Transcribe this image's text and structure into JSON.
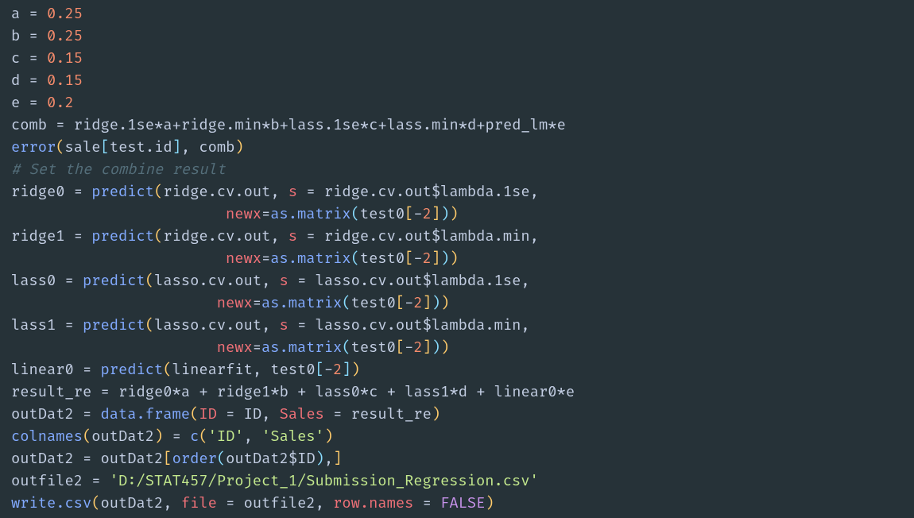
{
  "code": {
    "lines": [
      [
        {
          "c": "tok-id",
          "t": "a "
        },
        {
          "c": "tok-op",
          "t": "= "
        },
        {
          "c": "tok-num",
          "t": "0.25"
        }
      ],
      [
        {
          "c": "tok-id",
          "t": "b "
        },
        {
          "c": "tok-op",
          "t": "= "
        },
        {
          "c": "tok-num",
          "t": "0.25"
        }
      ],
      [
        {
          "c": "tok-id",
          "t": "c "
        },
        {
          "c": "tok-op",
          "t": "= "
        },
        {
          "c": "tok-num",
          "t": "0.15"
        }
      ],
      [
        {
          "c": "tok-id",
          "t": "d "
        },
        {
          "c": "tok-op",
          "t": "= "
        },
        {
          "c": "tok-num",
          "t": "0.15"
        }
      ],
      [
        {
          "c": "tok-id",
          "t": "e "
        },
        {
          "c": "tok-op",
          "t": "= "
        },
        {
          "c": "tok-num",
          "t": "0.2"
        }
      ],
      [
        {
          "c": "tok-id",
          "t": "comb "
        },
        {
          "c": "tok-op",
          "t": "= "
        },
        {
          "c": "tok-id",
          "t": "ridge.1se"
        },
        {
          "c": "tok-op",
          "t": "*"
        },
        {
          "c": "tok-id",
          "t": "a"
        },
        {
          "c": "tok-op",
          "t": "+"
        },
        {
          "c": "tok-id",
          "t": "ridge.min"
        },
        {
          "c": "tok-op",
          "t": "*"
        },
        {
          "c": "tok-id",
          "t": "b"
        },
        {
          "c": "tok-op",
          "t": "+"
        },
        {
          "c": "tok-id",
          "t": "lass.1se"
        },
        {
          "c": "tok-op",
          "t": "*"
        },
        {
          "c": "tok-id",
          "t": "c"
        },
        {
          "c": "tok-op",
          "t": "+"
        },
        {
          "c": "tok-id",
          "t": "lass.min"
        },
        {
          "c": "tok-op",
          "t": "*"
        },
        {
          "c": "tok-id",
          "t": "d"
        },
        {
          "c": "tok-op",
          "t": "+"
        },
        {
          "c": "tok-id",
          "t": "pred_lm"
        },
        {
          "c": "tok-op",
          "t": "*"
        },
        {
          "c": "tok-id",
          "t": "e"
        }
      ],
      [
        {
          "c": "tok-fn",
          "t": "error"
        },
        {
          "c": "tok-par",
          "t": "("
        },
        {
          "c": "tok-id",
          "t": "sale"
        },
        {
          "c": "tok-par2",
          "t": "["
        },
        {
          "c": "tok-id",
          "t": "test.id"
        },
        {
          "c": "tok-par2",
          "t": "]"
        },
        {
          "c": "tok-pun",
          "t": ", "
        },
        {
          "c": "tok-id",
          "t": "comb"
        },
        {
          "c": "tok-par",
          "t": ")"
        }
      ],
      [
        {
          "c": "tok-cmt",
          "t": "# Set the combine result"
        }
      ],
      [
        {
          "c": "tok-id",
          "t": "ridge0 "
        },
        {
          "c": "tok-op",
          "t": "= "
        },
        {
          "c": "tok-fn",
          "t": "predict"
        },
        {
          "c": "tok-par",
          "t": "("
        },
        {
          "c": "tok-id",
          "t": "ridge.cv.out"
        },
        {
          "c": "tok-pun",
          "t": ", "
        },
        {
          "c": "tok-arg",
          "t": "s "
        },
        {
          "c": "tok-op",
          "t": "= "
        },
        {
          "c": "tok-id",
          "t": "ridge.cv.out"
        },
        {
          "c": "tok-op",
          "t": "$"
        },
        {
          "c": "tok-id",
          "t": "lambda.1se"
        },
        {
          "c": "tok-pun",
          "t": ","
        }
      ],
      [
        {
          "c": "tok-id",
          "t": "                        "
        },
        {
          "c": "tok-arg",
          "t": "newx"
        },
        {
          "c": "tok-op",
          "t": "="
        },
        {
          "c": "tok-fn",
          "t": "as.matrix"
        },
        {
          "c": "tok-par2",
          "t": "("
        },
        {
          "c": "tok-id",
          "t": "test0"
        },
        {
          "c": "tok-par",
          "t": "["
        },
        {
          "c": "tok-op",
          "t": "-"
        },
        {
          "c": "tok-num",
          "t": "2"
        },
        {
          "c": "tok-par",
          "t": "]"
        },
        {
          "c": "tok-par2",
          "t": ")"
        },
        {
          "c": "tok-par",
          "t": ")"
        }
      ],
      [
        {
          "c": "tok-id",
          "t": "ridge1 "
        },
        {
          "c": "tok-op",
          "t": "= "
        },
        {
          "c": "tok-fn",
          "t": "predict"
        },
        {
          "c": "tok-par",
          "t": "("
        },
        {
          "c": "tok-id",
          "t": "ridge.cv.out"
        },
        {
          "c": "tok-pun",
          "t": ", "
        },
        {
          "c": "tok-arg",
          "t": "s "
        },
        {
          "c": "tok-op",
          "t": "= "
        },
        {
          "c": "tok-id",
          "t": "ridge.cv.out"
        },
        {
          "c": "tok-op",
          "t": "$"
        },
        {
          "c": "tok-id",
          "t": "lambda.min"
        },
        {
          "c": "tok-pun",
          "t": ","
        }
      ],
      [
        {
          "c": "tok-id",
          "t": "                        "
        },
        {
          "c": "tok-arg",
          "t": "newx"
        },
        {
          "c": "tok-op",
          "t": "="
        },
        {
          "c": "tok-fn",
          "t": "as.matrix"
        },
        {
          "c": "tok-par2",
          "t": "("
        },
        {
          "c": "tok-id",
          "t": "test0"
        },
        {
          "c": "tok-par",
          "t": "["
        },
        {
          "c": "tok-op",
          "t": "-"
        },
        {
          "c": "tok-num",
          "t": "2"
        },
        {
          "c": "tok-par",
          "t": "]"
        },
        {
          "c": "tok-par2",
          "t": ")"
        },
        {
          "c": "tok-par",
          "t": ")"
        }
      ],
      [
        {
          "c": "tok-id",
          "t": "lass0 "
        },
        {
          "c": "tok-op",
          "t": "= "
        },
        {
          "c": "tok-fn",
          "t": "predict"
        },
        {
          "c": "tok-par",
          "t": "("
        },
        {
          "c": "tok-id",
          "t": "lasso.cv.out"
        },
        {
          "c": "tok-pun",
          "t": ", "
        },
        {
          "c": "tok-arg",
          "t": "s "
        },
        {
          "c": "tok-op",
          "t": "= "
        },
        {
          "c": "tok-id",
          "t": "lasso.cv.out"
        },
        {
          "c": "tok-op",
          "t": "$"
        },
        {
          "c": "tok-id",
          "t": "lambda.1se"
        },
        {
          "c": "tok-pun",
          "t": ","
        }
      ],
      [
        {
          "c": "tok-id",
          "t": "                       "
        },
        {
          "c": "tok-arg",
          "t": "newx"
        },
        {
          "c": "tok-op",
          "t": "="
        },
        {
          "c": "tok-fn",
          "t": "as.matrix"
        },
        {
          "c": "tok-par2",
          "t": "("
        },
        {
          "c": "tok-id",
          "t": "test0"
        },
        {
          "c": "tok-par",
          "t": "["
        },
        {
          "c": "tok-op",
          "t": "-"
        },
        {
          "c": "tok-num",
          "t": "2"
        },
        {
          "c": "tok-par",
          "t": "]"
        },
        {
          "c": "tok-par2",
          "t": ")"
        },
        {
          "c": "tok-par",
          "t": ")"
        }
      ],
      [
        {
          "c": "tok-id",
          "t": "lass1 "
        },
        {
          "c": "tok-op",
          "t": "= "
        },
        {
          "c": "tok-fn",
          "t": "predict"
        },
        {
          "c": "tok-par",
          "t": "("
        },
        {
          "c": "tok-id",
          "t": "lasso.cv.out"
        },
        {
          "c": "tok-pun",
          "t": ", "
        },
        {
          "c": "tok-arg",
          "t": "s "
        },
        {
          "c": "tok-op",
          "t": "= "
        },
        {
          "c": "tok-id",
          "t": "lasso.cv.out"
        },
        {
          "c": "tok-op",
          "t": "$"
        },
        {
          "c": "tok-id",
          "t": "lambda.min"
        },
        {
          "c": "tok-pun",
          "t": ","
        }
      ],
      [
        {
          "c": "tok-id",
          "t": "                       "
        },
        {
          "c": "tok-arg",
          "t": "newx"
        },
        {
          "c": "tok-op",
          "t": "="
        },
        {
          "c": "tok-fn",
          "t": "as.matrix"
        },
        {
          "c": "tok-par2",
          "t": "("
        },
        {
          "c": "tok-id",
          "t": "test0"
        },
        {
          "c": "tok-par",
          "t": "["
        },
        {
          "c": "tok-op",
          "t": "-"
        },
        {
          "c": "tok-num",
          "t": "2"
        },
        {
          "c": "tok-par",
          "t": "]"
        },
        {
          "c": "tok-par2",
          "t": ")"
        },
        {
          "c": "tok-par",
          "t": ")"
        }
      ],
      [
        {
          "c": "tok-id",
          "t": "linear0 "
        },
        {
          "c": "tok-op",
          "t": "= "
        },
        {
          "c": "tok-fn",
          "t": "predict"
        },
        {
          "c": "tok-par",
          "t": "("
        },
        {
          "c": "tok-id",
          "t": "linearfit"
        },
        {
          "c": "tok-pun",
          "t": ", "
        },
        {
          "c": "tok-id",
          "t": "test0"
        },
        {
          "c": "tok-par2",
          "t": "["
        },
        {
          "c": "tok-op",
          "t": "-"
        },
        {
          "c": "tok-num",
          "t": "2"
        },
        {
          "c": "tok-par2",
          "t": "]"
        },
        {
          "c": "tok-par",
          "t": ")"
        }
      ],
      [
        {
          "c": "tok-id",
          "t": "result_re "
        },
        {
          "c": "tok-op",
          "t": "= "
        },
        {
          "c": "tok-id",
          "t": "ridge0"
        },
        {
          "c": "tok-op",
          "t": "*"
        },
        {
          "c": "tok-id",
          "t": "a "
        },
        {
          "c": "tok-op",
          "t": "+ "
        },
        {
          "c": "tok-id",
          "t": "ridge1"
        },
        {
          "c": "tok-op",
          "t": "*"
        },
        {
          "c": "tok-id",
          "t": "b "
        },
        {
          "c": "tok-op",
          "t": "+ "
        },
        {
          "c": "tok-id",
          "t": "lass0"
        },
        {
          "c": "tok-op",
          "t": "*"
        },
        {
          "c": "tok-id",
          "t": "c "
        },
        {
          "c": "tok-op",
          "t": "+ "
        },
        {
          "c": "tok-id",
          "t": "lass1"
        },
        {
          "c": "tok-op",
          "t": "*"
        },
        {
          "c": "tok-id",
          "t": "d "
        },
        {
          "c": "tok-op",
          "t": "+ "
        },
        {
          "c": "tok-id",
          "t": "linear0"
        },
        {
          "c": "tok-op",
          "t": "*"
        },
        {
          "c": "tok-id",
          "t": "e"
        }
      ],
      [
        {
          "c": "tok-id",
          "t": "outDat2 "
        },
        {
          "c": "tok-op",
          "t": "= "
        },
        {
          "c": "tok-fn",
          "t": "data.frame"
        },
        {
          "c": "tok-par",
          "t": "("
        },
        {
          "c": "tok-arg",
          "t": "ID "
        },
        {
          "c": "tok-op",
          "t": "= "
        },
        {
          "c": "tok-id",
          "t": "ID"
        },
        {
          "c": "tok-pun",
          "t": ", "
        },
        {
          "c": "tok-arg",
          "t": "Sales "
        },
        {
          "c": "tok-op",
          "t": "= "
        },
        {
          "c": "tok-id",
          "t": "result_re"
        },
        {
          "c": "tok-par",
          "t": ")"
        }
      ],
      [
        {
          "c": "tok-fn",
          "t": "colnames"
        },
        {
          "c": "tok-par",
          "t": "("
        },
        {
          "c": "tok-id",
          "t": "outDat2"
        },
        {
          "c": "tok-par",
          "t": ")"
        },
        {
          "c": "tok-op",
          "t": " = "
        },
        {
          "c": "tok-fn",
          "t": "c"
        },
        {
          "c": "tok-par",
          "t": "("
        },
        {
          "c": "tok-str",
          "t": "'ID'"
        },
        {
          "c": "tok-pun",
          "t": ", "
        },
        {
          "c": "tok-str",
          "t": "'Sales'"
        },
        {
          "c": "tok-par",
          "t": ")"
        }
      ],
      [
        {
          "c": "tok-id",
          "t": "outDat2 "
        },
        {
          "c": "tok-op",
          "t": "= "
        },
        {
          "c": "tok-id",
          "t": "outDat2"
        },
        {
          "c": "tok-par",
          "t": "["
        },
        {
          "c": "tok-fn",
          "t": "order"
        },
        {
          "c": "tok-par2",
          "t": "("
        },
        {
          "c": "tok-id",
          "t": "outDat2"
        },
        {
          "c": "tok-op",
          "t": "$"
        },
        {
          "c": "tok-id",
          "t": "ID"
        },
        {
          "c": "tok-par2",
          "t": ")"
        },
        {
          "c": "tok-pun",
          "t": ","
        },
        {
          "c": "tok-par",
          "t": "]"
        }
      ],
      [
        {
          "c": "tok-id",
          "t": "outfile2 "
        },
        {
          "c": "tok-op",
          "t": "= "
        },
        {
          "c": "tok-str",
          "t": "'D:/STAT457/Project_1/Submission_Regression.csv'"
        }
      ],
      [
        {
          "c": "tok-fn",
          "t": "write.csv"
        },
        {
          "c": "tok-par",
          "t": "("
        },
        {
          "c": "tok-id",
          "t": "outDat2"
        },
        {
          "c": "tok-pun",
          "t": ", "
        },
        {
          "c": "tok-arg",
          "t": "file "
        },
        {
          "c": "tok-op",
          "t": "= "
        },
        {
          "c": "tok-id",
          "t": "outfile2"
        },
        {
          "c": "tok-pun",
          "t": ", "
        },
        {
          "c": "tok-arg",
          "t": "row.names "
        },
        {
          "c": "tok-op",
          "t": "= "
        },
        {
          "c": "tok-kw",
          "t": "FALSE"
        },
        {
          "c": "tok-par",
          "t": ")"
        }
      ]
    ]
  }
}
